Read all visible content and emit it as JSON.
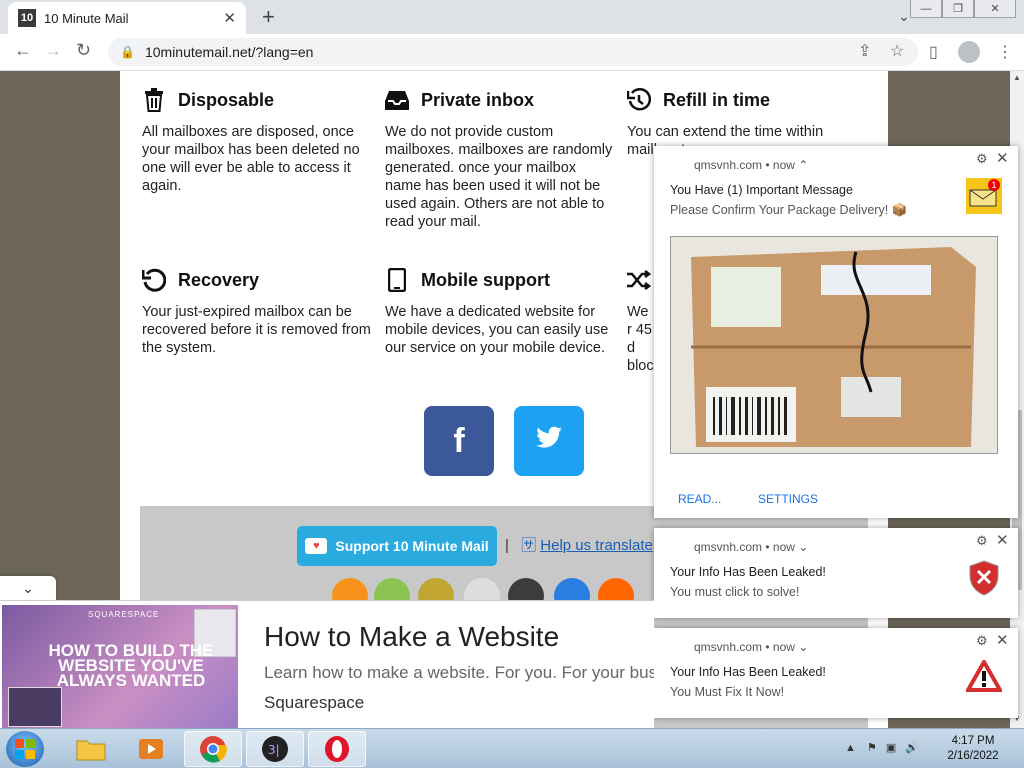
{
  "browser": {
    "tab_title": "10 Minute Mail",
    "favicon_text": "10",
    "url": "10minutemail.net/?lang=en"
  },
  "features": [
    {
      "title": "Disposable",
      "icon": "trash-icon",
      "text": "All mailboxes are disposed, once your mailbox has been deleted no one will ever be able to access it again."
    },
    {
      "title": "Private inbox",
      "icon": "inbox-icon",
      "text": "We do not provide custom mailboxes. mailboxes are randomly generated. once your mailbox name has been used it will not be used again. Others are not able to read your mail."
    },
    {
      "title": "Refill in time",
      "icon": "history-icon",
      "text": "You can extend the time within maill up to"
    },
    {
      "title": "Recovery",
      "icon": "undo-icon",
      "text": "Your just-expired mailbox can be recovered before it is removed from the system."
    },
    {
      "title": "Mobile support",
      "icon": "mobile-icon",
      "text": "We have a dedicated website for mobile devices, you can easily use our service on your mobile device."
    },
    {
      "title": "",
      "icon": "shuffle-icon",
      "text": "We r 45 d block"
    }
  ],
  "social": {
    "facebook": "f",
    "twitter": "twitter-bird"
  },
  "footer": {
    "support_label": "Support 10 Minute Mail",
    "separator": "|",
    "help_label": "Help us translate"
  },
  "notifications": [
    {
      "source": "qmsvnh.com",
      "time": "now",
      "title": "You Have (1) Important Message",
      "body": "Please Confirm Your Package Delivery! 📦",
      "badge_count": "1",
      "actions": [
        "READ...",
        "SETTINGS"
      ]
    },
    {
      "source": "qmsvnh.com",
      "time": "now",
      "title": "Your Info Has Been Leaked!",
      "body": "You must click to solve!"
    },
    {
      "source": "qmsvnh.com",
      "time": "now",
      "title": "Your Info Has Been Leaked!",
      "body": "You Must Fix It Now!"
    }
  ],
  "ad": {
    "brand": "SQUARESPACE",
    "headline": "HOW TO BUILD THE WEBSITE YOU'VE ALWAYS WANTED",
    "title": "How to Make a Website",
    "description": "Learn how to make a website. For you. For your business.",
    "advertiser": "Squarespace"
  },
  "taskbar": {
    "time": "4:17 PM",
    "date": "2/16/2022"
  },
  "colors": {
    "facebook": "#3b5998",
    "twitter": "#1da1f2",
    "support": "#29abe0",
    "page_bg": "#6c6658"
  }
}
